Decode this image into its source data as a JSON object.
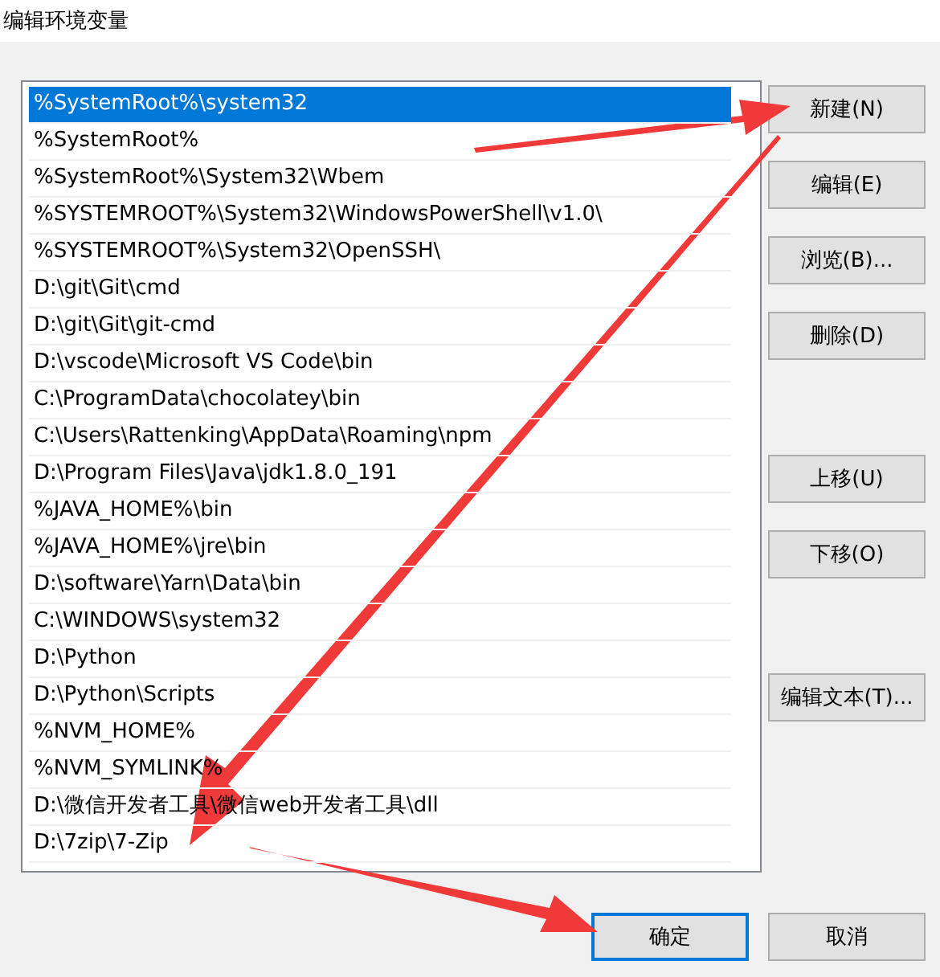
{
  "window": {
    "title": "编辑环境变量"
  },
  "paths": [
    {
      "text": "%SystemRoot%\\system32",
      "selected": true
    },
    {
      "text": "%SystemRoot%",
      "selected": false
    },
    {
      "text": "%SystemRoot%\\System32\\Wbem",
      "selected": false
    },
    {
      "text": "%SYSTEMROOT%\\System32\\WindowsPowerShell\\v1.0\\",
      "selected": false
    },
    {
      "text": "%SYSTEMROOT%\\System32\\OpenSSH\\",
      "selected": false
    },
    {
      "text": "D:\\git\\Git\\cmd",
      "selected": false
    },
    {
      "text": "D:\\git\\Git\\git-cmd",
      "selected": false
    },
    {
      "text": "D:\\vscode\\Microsoft VS Code\\bin",
      "selected": false
    },
    {
      "text": "C:\\ProgramData\\chocolatey\\bin",
      "selected": false
    },
    {
      "text": "C:\\Users\\Rattenking\\AppData\\Roaming\\npm",
      "selected": false
    },
    {
      "text": "D:\\Program Files\\Java\\jdk1.8.0_191",
      "selected": false
    },
    {
      "text": "%JAVA_HOME%\\bin",
      "selected": false
    },
    {
      "text": "%JAVA_HOME%\\jre\\bin",
      "selected": false
    },
    {
      "text": "D:\\software\\Yarn\\Data\\bin",
      "selected": false
    },
    {
      "text": "C:\\WINDOWS\\system32",
      "selected": false
    },
    {
      "text": "D:\\Python",
      "selected": false
    },
    {
      "text": "D:\\Python\\Scripts",
      "selected": false
    },
    {
      "text": "%NVM_HOME%",
      "selected": false
    },
    {
      "text": "%NVM_SYMLINK%",
      "selected": false
    },
    {
      "text": "D:\\微信开发者工具\\微信web开发者工具\\dll",
      "selected": false
    },
    {
      "text": "D:\\7zip\\7-Zip",
      "selected": false
    }
  ],
  "side_button_groups": [
    {
      "buttons": [
        "新建(N)",
        "编辑(E)",
        "浏览(B)...",
        "删除(D)"
      ]
    },
    {
      "buttons": [
        "上移(U)",
        "下移(O)"
      ]
    },
    {
      "buttons": [
        "编辑文本(T)..."
      ]
    }
  ],
  "dialog_buttons": [
    {
      "label": "确定",
      "default": true
    },
    {
      "label": "取消",
      "default": false
    }
  ]
}
